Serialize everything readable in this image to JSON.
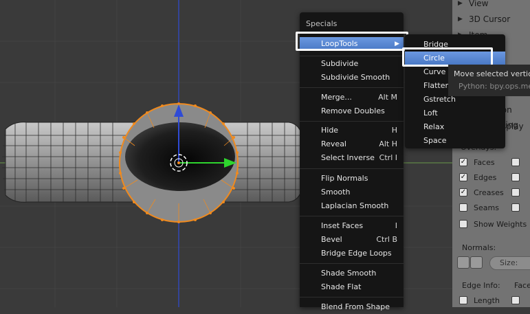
{
  "specials_menu": {
    "title": "Specials",
    "items": [
      {
        "label": "LoopTools",
        "shortcut": "",
        "submenu": true
      },
      {
        "label": "Subdivide",
        "shortcut": ""
      },
      {
        "label": "Subdivide Smooth",
        "shortcut": ""
      },
      {
        "label": "Merge...",
        "shortcut": "Alt M"
      },
      {
        "label": "Remove Doubles",
        "shortcut": ""
      },
      {
        "label": "Hide",
        "shortcut": "H"
      },
      {
        "label": "Reveal",
        "shortcut": "Alt H"
      },
      {
        "label": "Select Inverse",
        "shortcut": "Ctrl I"
      },
      {
        "label": "Flip Normals",
        "shortcut": ""
      },
      {
        "label": "Smooth",
        "shortcut": ""
      },
      {
        "label": "Laplacian Smooth",
        "shortcut": ""
      },
      {
        "label": "Inset Faces",
        "shortcut": "I"
      },
      {
        "label": "Bevel",
        "shortcut": "Ctrl B"
      },
      {
        "label": "Bridge Edge Loops",
        "shortcut": ""
      },
      {
        "label": "Shade Smooth",
        "shortcut": ""
      },
      {
        "label": "Shade Flat",
        "shortcut": ""
      },
      {
        "label": "Blend From Shape",
        "shortcut": ""
      }
    ]
  },
  "looptools_menu": {
    "items": [
      "Bridge",
      "Circle",
      "Curve",
      "Flatten",
      "Gstretch",
      "Loft",
      "Relax",
      "Space"
    ],
    "active": "Circle"
  },
  "tooltip": {
    "description": "Move selected vertices into a circle shape",
    "python": "Python: bpy.ops.mesh.looptools_circle()"
  },
  "properties_panel": {
    "view_label": "View",
    "cursor_label": "3D Cursor",
    "item_label": "Item",
    "motion_tracking_label": "Motion Tracking",
    "mesh_display_label": "Mesh Display",
    "overlays_label": "Overlays:",
    "faces_label": "Faces",
    "edges_label": "Edges",
    "creases_label": "Creases",
    "seams_label": "Seams",
    "show_weights_label": "Show Weights",
    "normals_label": "Normals:",
    "size_placeholder": "Size:",
    "edge_info_label": "Edge Info:",
    "face_info_label": "Face Info:",
    "length_label": "Length",
    "check_mark": "✓",
    "faces_checked": true,
    "edges_checked": true,
    "creases_checked": true,
    "seams_checked": false,
    "show_weights_checked": false
  },
  "colors": {
    "menu_bg": "#151515",
    "highlight": "#5680c2",
    "mesh_selected_edge": "#f08a1e",
    "axis_x": "#2ed62e",
    "axis_z": "#2f4bd6"
  }
}
